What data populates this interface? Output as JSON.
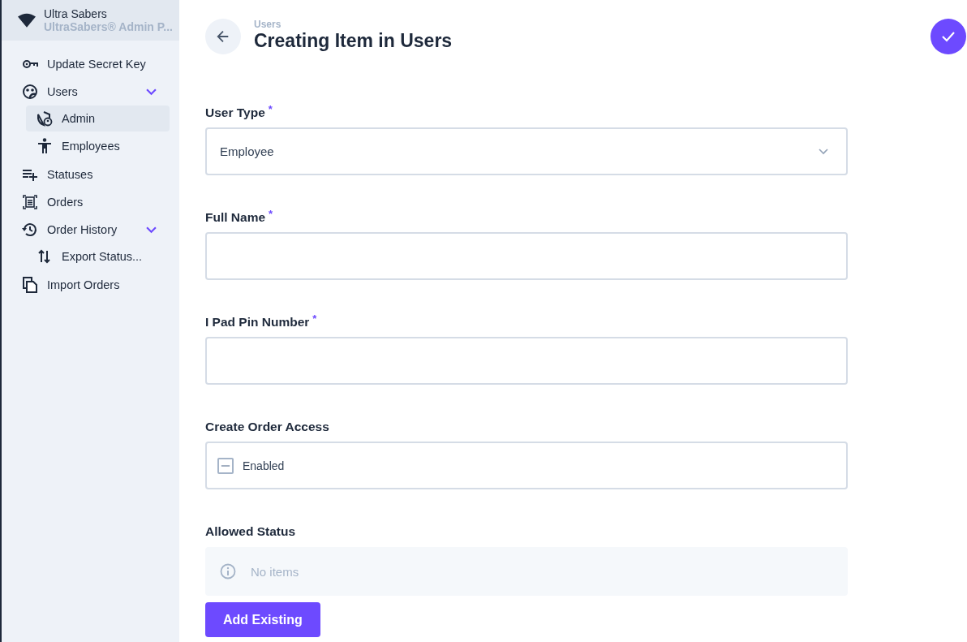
{
  "app": {
    "name": "Ultra Sabers",
    "subtitle": "UltraSabers® Admin P..."
  },
  "sidebar": {
    "items": [
      {
        "label": "Update Secret Key",
        "selected": false
      },
      {
        "label": "Users",
        "selected": false,
        "expanded": true,
        "children": [
          {
            "label": "Admin",
            "selected": true
          },
          {
            "label": "Employees",
            "selected": false
          }
        ]
      },
      {
        "label": "Statuses",
        "selected": false
      },
      {
        "label": "Orders",
        "selected": false
      },
      {
        "label": "Order History",
        "selected": false,
        "expanded": true,
        "children": [
          {
            "label": "Export Status...",
            "selected": false
          }
        ]
      },
      {
        "label": "Import Orders",
        "selected": false
      }
    ]
  },
  "header": {
    "breadcrumb": "Users",
    "title": "Creating Item in Users"
  },
  "form": {
    "fields": [
      {
        "kind": "select",
        "label": "User Type",
        "required_mark": "*",
        "value": "Employee"
      },
      {
        "kind": "text",
        "label": "Full Name",
        "required_mark": "*"
      },
      {
        "kind": "text",
        "label": "I Pad Pin Number",
        "required_mark": "*"
      },
      {
        "kind": "checkbox",
        "label": "Create Order Access",
        "option": "Enabled",
        "indeterminate": true
      },
      {
        "kind": "list",
        "label": "Allowed Status",
        "empty_text": "No items",
        "button": "Add Existing"
      }
    ]
  }
}
